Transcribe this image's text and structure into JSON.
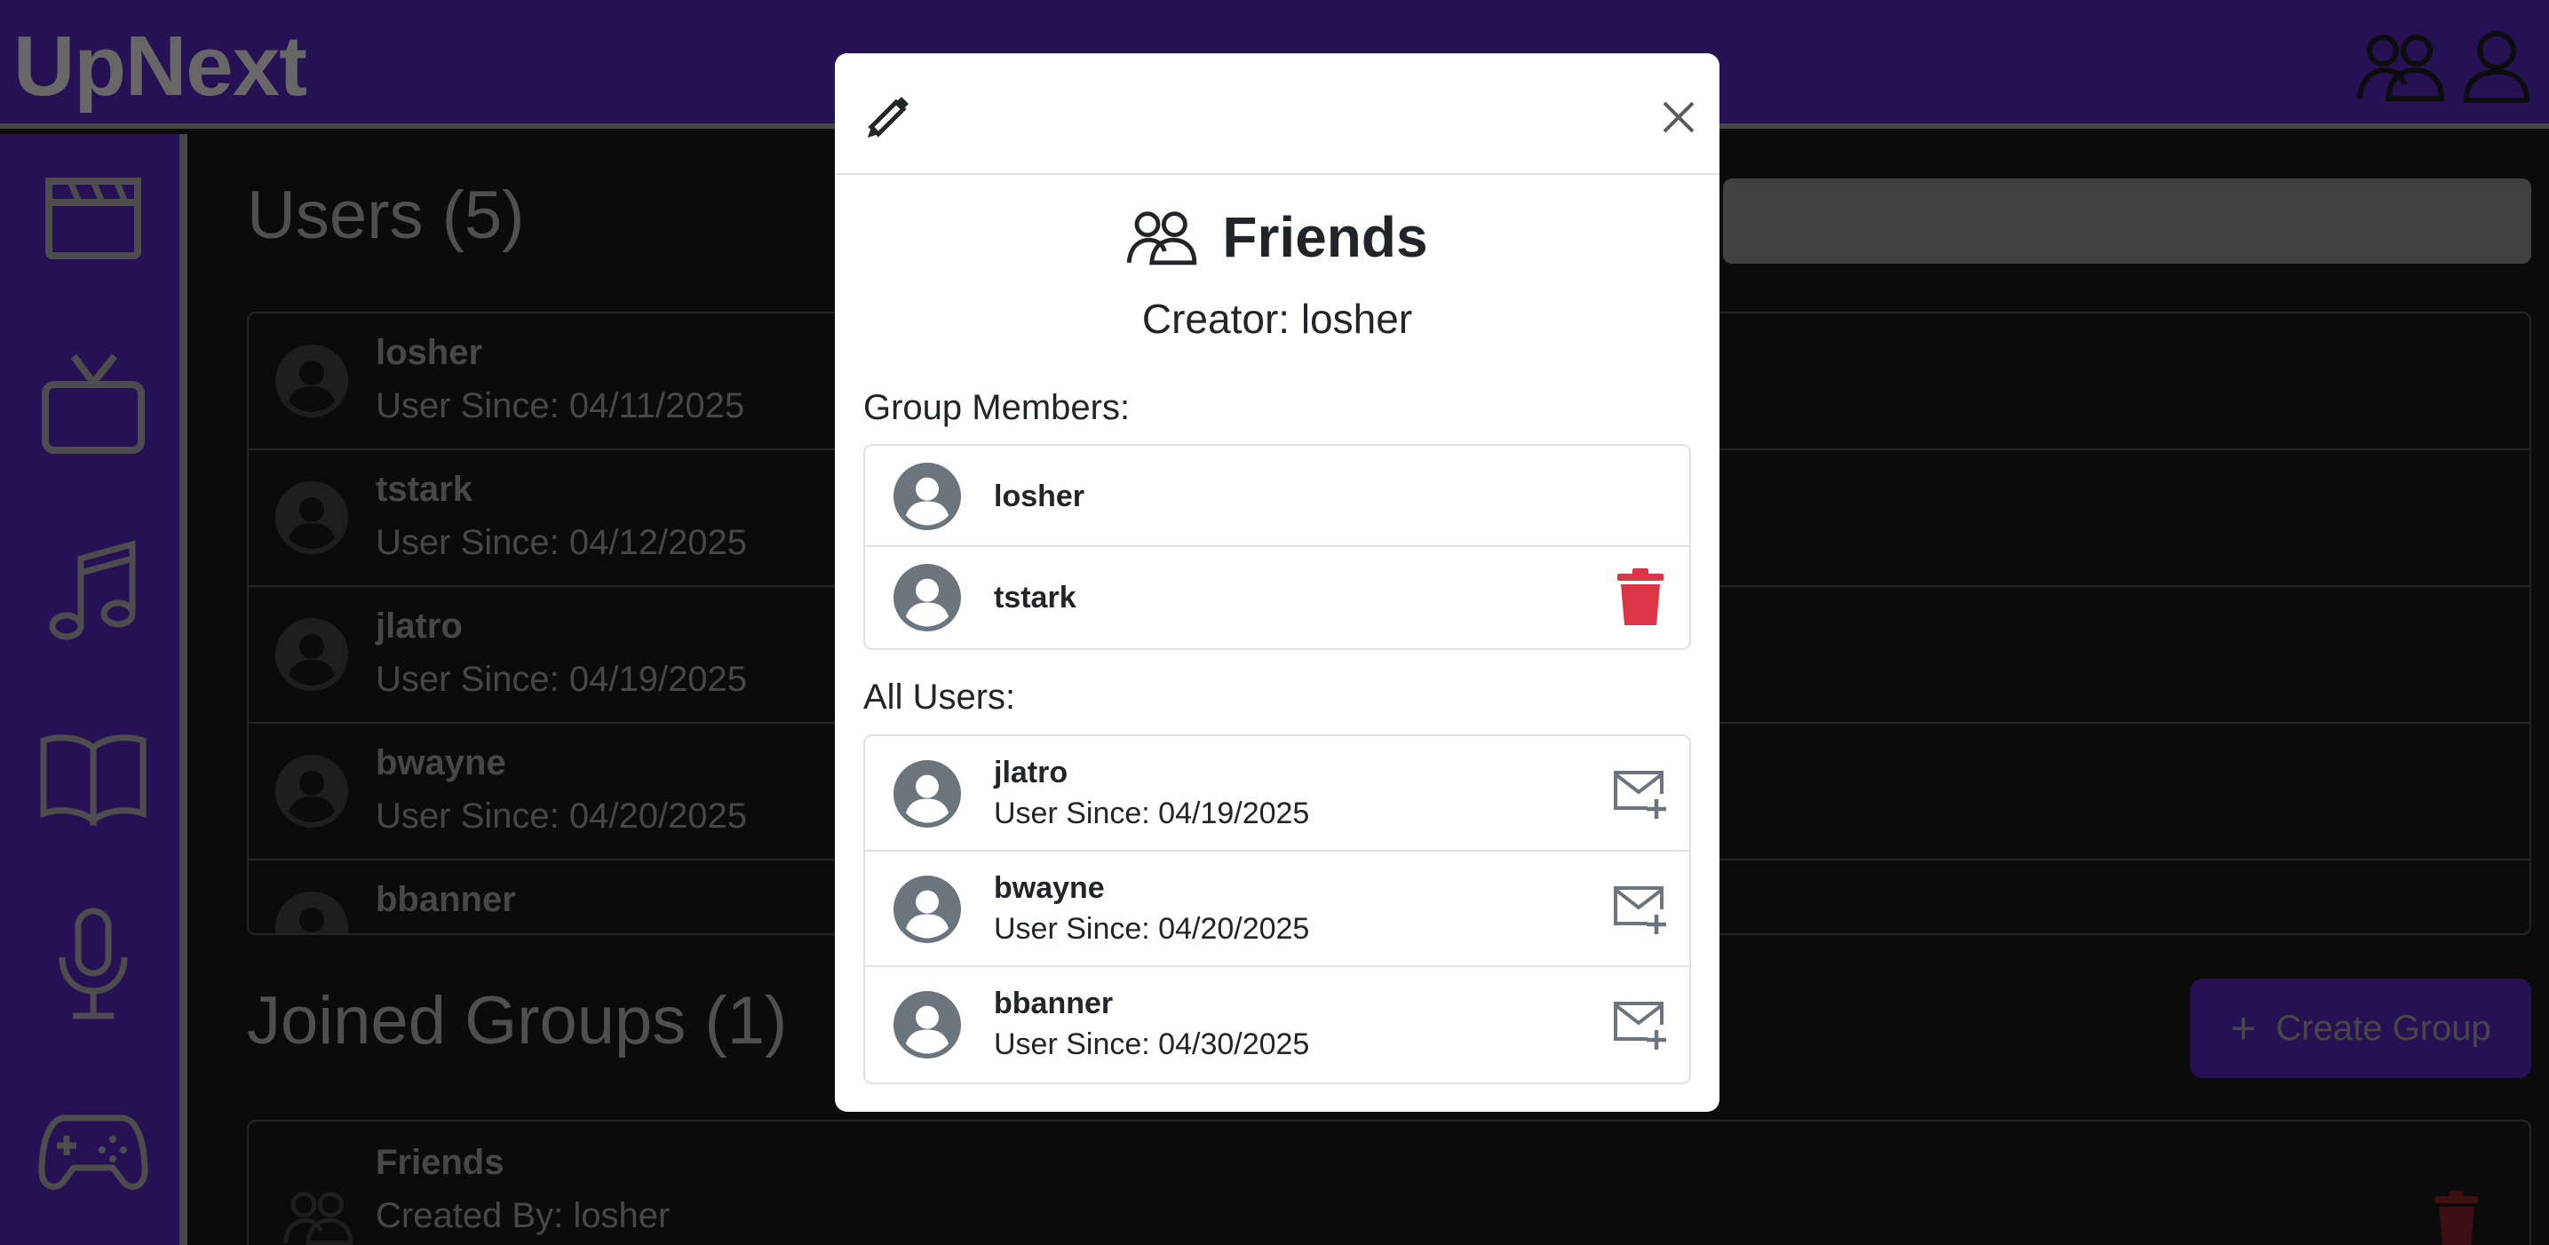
{
  "header": {
    "brand": "UpNext",
    "groups_icon": "people-icon",
    "profile_icon": "person-icon"
  },
  "sidebar": {
    "items": [
      {
        "icon": "film-icon"
      },
      {
        "icon": "tv-icon"
      },
      {
        "icon": "music-note-icon"
      },
      {
        "icon": "book-icon"
      },
      {
        "icon": "microphone-icon"
      },
      {
        "icon": "gamepad-icon"
      }
    ]
  },
  "main": {
    "users_title": "Users (5)",
    "users": [
      {
        "name": "losher",
        "since": "User Since: 04/11/2025"
      },
      {
        "name": "tstark",
        "since": "User Since: 04/12/2025"
      },
      {
        "name": "jlatro",
        "since": "User Since: 04/19/2025"
      },
      {
        "name": "bwayne",
        "since": "User Since: 04/20/2025"
      },
      {
        "name": "bbanner",
        "since": ""
      }
    ],
    "groups_title": "Joined Groups (1)",
    "create_group_label": "Create Group",
    "groups": [
      {
        "name": "Friends",
        "created_by": "Created By: losher"
      }
    ]
  },
  "modal": {
    "title": "Friends",
    "creator": "Creator: losher",
    "members_label": "Group Members:",
    "members": [
      {
        "name": "losher",
        "removable": false
      },
      {
        "name": "tstark",
        "removable": true
      }
    ],
    "all_users_label": "All Users:",
    "all_users": [
      {
        "name": "jlatro",
        "since": "User Since: 04/19/2025"
      },
      {
        "name": "bwayne",
        "since": "User Since: 04/20/2025"
      },
      {
        "name": "bbanner",
        "since": "User Since: 04/30/2025"
      }
    ]
  },
  "colors": {
    "brand_purple": "#4b22a6",
    "danger": "#dc3545",
    "muted_icon": "#6c757d",
    "background": "#171717"
  }
}
